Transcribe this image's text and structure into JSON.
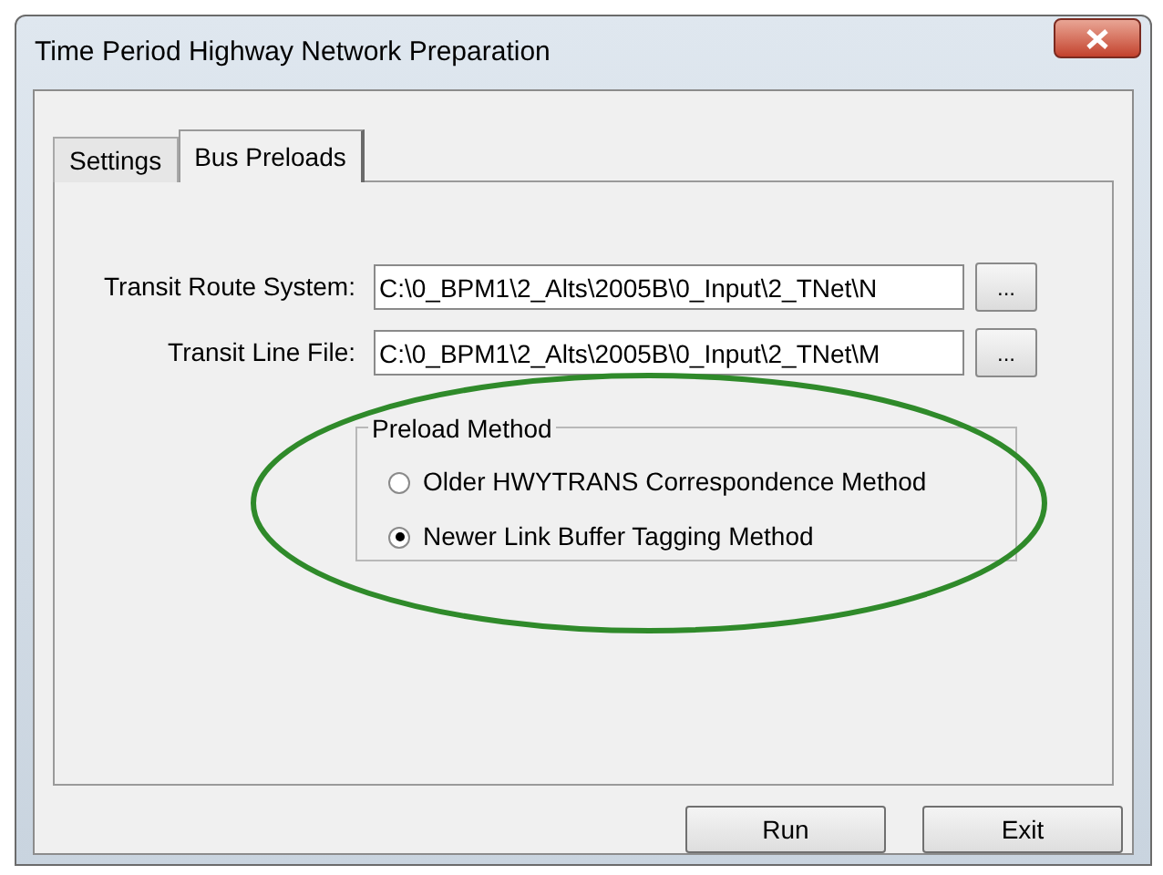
{
  "window": {
    "title": "Time Period Highway Network Preparation"
  },
  "tabs": [
    {
      "label": "Settings",
      "selected": false
    },
    {
      "label": "Bus Preloads",
      "selected": true
    }
  ],
  "fields": [
    {
      "label": "Transit Route System:",
      "value": "C:\\0_BPM1\\2_Alts\\2005B\\0_Input\\2_TNet\\N",
      "browse": "..."
    },
    {
      "label": "Transit Line File:",
      "value": "C:\\0_BPM1\\2_Alts\\2005B\\0_Input\\2_TNet\\M",
      "browse": "..."
    }
  ],
  "preload_method": {
    "title": "Preload Method",
    "options": [
      {
        "label": "Older HWYTRANS Correspondence Method",
        "selected": false
      },
      {
        "label": "Newer Link Buffer Tagging Method",
        "selected": true
      }
    ]
  },
  "buttons": [
    "Run",
    "Exit"
  ]
}
